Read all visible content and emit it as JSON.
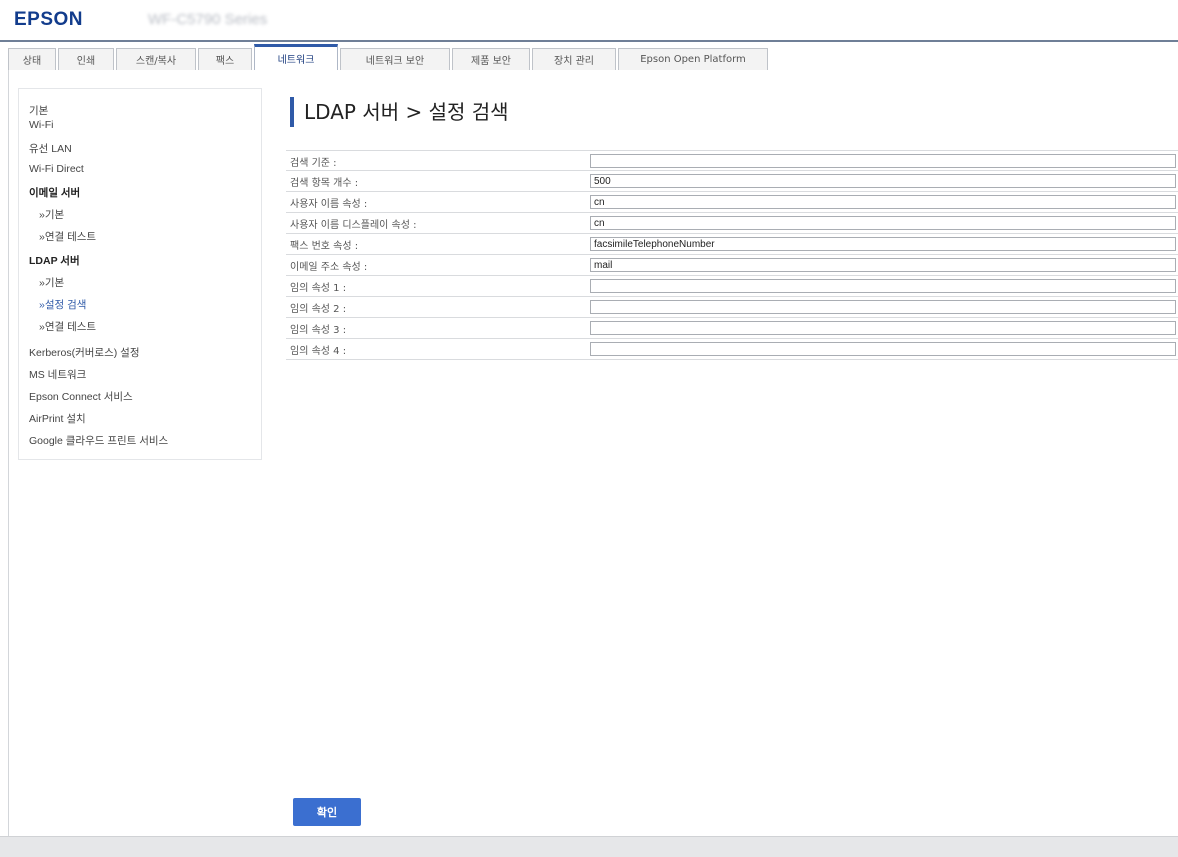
{
  "header": {
    "logo": "EPSON",
    "model": "WF-C5790 Series"
  },
  "tabs": [
    {
      "label": "상태",
      "active": false
    },
    {
      "label": "인쇄",
      "active": false
    },
    {
      "label": "스캔/복사",
      "active": false
    },
    {
      "label": "팩스",
      "active": false
    },
    {
      "label": "네트워크",
      "active": true
    },
    {
      "label": "네트워크 보안",
      "active": false
    },
    {
      "label": "제품 보안",
      "active": false
    },
    {
      "label": "장치 관리",
      "active": false
    },
    {
      "label": "Epson Open Platform",
      "active": false
    }
  ],
  "sidebar": {
    "items": [
      {
        "label": "기본"
      },
      {
        "label": "Wi-Fi"
      },
      {
        "label": "유선 LAN"
      },
      {
        "label": "Wi-Fi Direct"
      },
      {
        "label": "이메일 서버"
      },
      {
        "label": "»기본"
      },
      {
        "label": "»연결 테스트"
      },
      {
        "label": "LDAP 서버"
      },
      {
        "label": "»기본"
      },
      {
        "label": "»설정 검색"
      },
      {
        "label": "»연결 테스트"
      },
      {
        "label": "Kerberos(커버로스) 설정"
      },
      {
        "label": "MS 네트워크"
      },
      {
        "label": "Epson Connect 서비스"
      },
      {
        "label": "AirPrint 설치"
      },
      {
        "label": "Google 클라우드 프린트 서비스"
      }
    ]
  },
  "page": {
    "title": "LDAP 서버 > 설정 검색"
  },
  "form": {
    "rows": [
      {
        "label": "검색 기준 :",
        "value": ""
      },
      {
        "label": "검색 항목 개수 :",
        "value": "500"
      },
      {
        "label": "사용자 이름 속성 :",
        "value": "cn"
      },
      {
        "label": "사용자 이름 디스플레이 속성 :",
        "value": "cn"
      },
      {
        "label": "팩스 번호 속성 :",
        "value": "facsimileTelephoneNumber"
      },
      {
        "label": "이메일 주소 속성 :",
        "value": "mail"
      },
      {
        "label": "임의 속성 1 :",
        "value": ""
      },
      {
        "label": "임의 속성 2 :",
        "value": ""
      },
      {
        "label": "임의 속성 3 :",
        "value": ""
      },
      {
        "label": "임의 속성 4 :",
        "value": ""
      }
    ]
  },
  "buttons": {
    "ok_label": "확인"
  },
  "colors": {
    "brand": "#123c8c",
    "accent": "#2f5aa8",
    "button": "#3b6fd0"
  }
}
